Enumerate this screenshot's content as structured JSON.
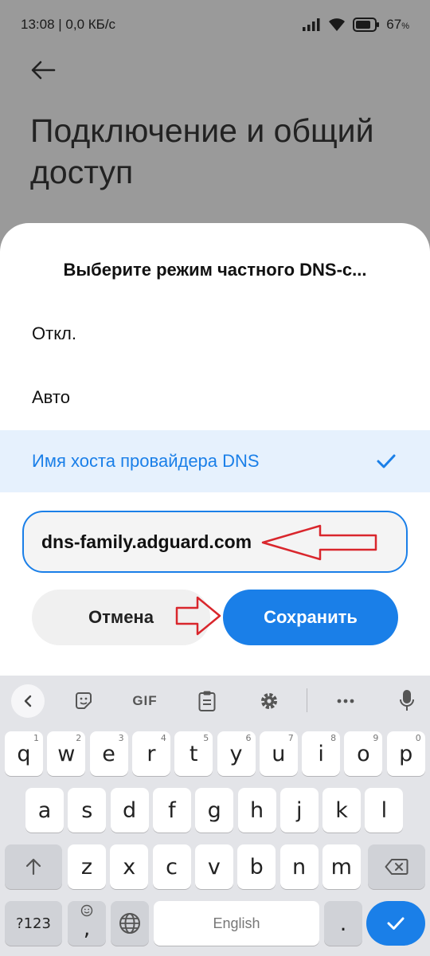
{
  "status_bar": {
    "time_speed": "13:08 | 0,0 КБ/с",
    "battery": "67"
  },
  "page": {
    "title": "Подключение и общий доступ"
  },
  "dialog": {
    "title": "Выберите режим частного DNS-с...",
    "options": [
      {
        "label": "Откл."
      },
      {
        "label": "Авто"
      },
      {
        "label": "Имя хоста провайдера DNS",
        "selected": true
      }
    ],
    "hostname_value": "dns-family.adguard.com",
    "cancel_label": "Отмена",
    "save_label": "Сохранить"
  },
  "keyboard": {
    "toolbar": {
      "gif_label": "GIF"
    },
    "row1": [
      {
        "k": "q",
        "h": "1"
      },
      {
        "k": "w",
        "h": "2"
      },
      {
        "k": "e",
        "h": "3"
      },
      {
        "k": "r",
        "h": "4"
      },
      {
        "k": "t",
        "h": "5"
      },
      {
        "k": "y",
        "h": "6"
      },
      {
        "k": "u",
        "h": "7"
      },
      {
        "k": "i",
        "h": "8"
      },
      {
        "k": "o",
        "h": "9"
      },
      {
        "k": "p",
        "h": "0"
      }
    ],
    "row2": [
      "a",
      "s",
      "d",
      "f",
      "g",
      "h",
      "j",
      "k",
      "l"
    ],
    "row3": [
      "z",
      "x",
      "c",
      "v",
      "b",
      "n",
      "m"
    ],
    "symbols_label": "?123",
    "comma": ",",
    "space_label": "English",
    "period": "."
  },
  "colors": {
    "accent": "#1a7fe8",
    "selected_bg": "#e6f1fd",
    "annotation_arrow": "#d9262c"
  }
}
